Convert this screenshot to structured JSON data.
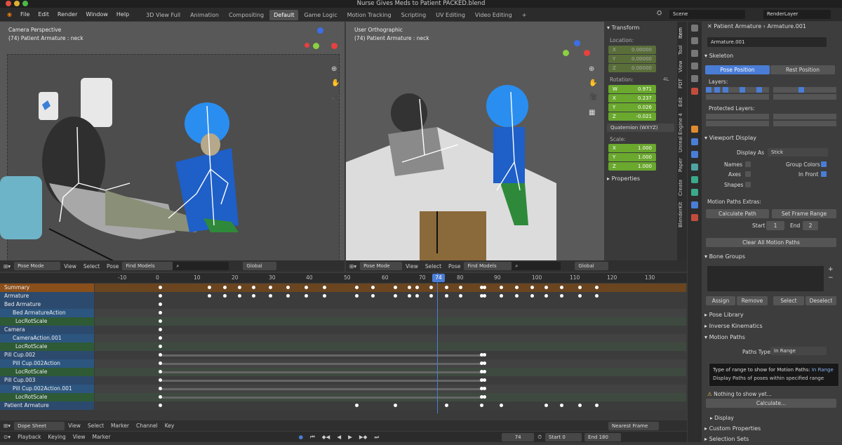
{
  "window_title": "Nurse Gives Meds to Patient PACKED.blend",
  "menus": [
    "File",
    "Edit",
    "Render",
    "Window",
    "Help"
  ],
  "workspaces": [
    "3D View Full",
    "Animation",
    "Compositing",
    "Default",
    "Game Logic",
    "Motion Tracking",
    "Scripting",
    "UV Editing",
    "Video Editing",
    "+"
  ],
  "active_workspace": "Default",
  "scene": "Scene",
  "render_layer": "RenderLayer",
  "left_viewport": {
    "label": "Camera Perspective",
    "sub": "(74) Patient Armature : neck"
  },
  "right_viewport": {
    "label": "User Orthographic",
    "sub": "(74) Patient Armature : neck"
  },
  "viewport_header": {
    "mode": "Pose Mode",
    "view": "View",
    "select": "Select",
    "pose": "Pose",
    "find": "Find Models",
    "orientation": "Global"
  },
  "transform": {
    "title": "Transform",
    "location_label": "Location:",
    "loc": [
      {
        "axis": "X",
        "val": "0.00000"
      },
      {
        "axis": "Y",
        "val": "0.00000"
      },
      {
        "axis": "Z",
        "val": "0.00000"
      }
    ],
    "rotation_label": "Rotation:",
    "rot_mode_tag": "4L",
    "rot": [
      {
        "axis": "W",
        "val": "0.971"
      },
      {
        "axis": "X",
        "val": "0.237"
      },
      {
        "axis": "Y",
        "val": "0.026"
      },
      {
        "axis": "Z",
        "val": "-0.021"
      }
    ],
    "rot_mode": "Quaternion (WXYZ)",
    "scale_label": "Scale:",
    "scale": [
      {
        "axis": "X",
        "val": "1.000"
      },
      {
        "axis": "Y",
        "val": "1.000"
      },
      {
        "axis": "Z",
        "val": "1.000"
      }
    ],
    "properties": "Properties"
  },
  "side_tabs": [
    "Item",
    "Tool",
    "View",
    "PDT",
    "Edit",
    "Unreal Engine 4",
    "Paper",
    "Create",
    "BlenderKit"
  ],
  "props": {
    "object": "Patient Armature",
    "data": "Armature.001",
    "name_field": "Armature.001",
    "skeleton": "Skeleton",
    "pose_position": "Pose Position",
    "rest_position": "Rest Position",
    "layers": "Layers:",
    "protected_layers": "Protected Layers:",
    "viewport_display": "Viewport Display",
    "display_as_label": "Display As",
    "display_as": "Stick",
    "names": "Names",
    "group_colors": "Group Colors",
    "axes": "Axes",
    "in_front": "In Front",
    "shapes": "Shapes",
    "motion_extras": "Motion Paths Extras:",
    "calculate_path": "Calculate Path",
    "set_frame_range": "Set Frame Range",
    "start_label": "Start",
    "start_val": "1",
    "end_label": "End",
    "end_val": "2",
    "clear_all": "Clear All Motion Paths",
    "bone_groups": "Bone Groups",
    "assign": "Assign",
    "remove": "Remove",
    "select": "Select",
    "deselect": "Deselect",
    "pose_library": "Pose Library",
    "inverse_kinematics": "Inverse Kinematics",
    "motion_paths": "Motion Paths",
    "paths_type_label": "Paths Type",
    "paths_type": "In Range",
    "tooltip_title": "Type of range to show for Motion Paths:",
    "tooltip_value": "In Range",
    "tooltip_desc": "Display Paths of poses within specified range",
    "nothing": "Nothing to show yet...",
    "calculate": "Calculate...",
    "display": "Display",
    "custom_props": "Custom Properties",
    "selection_sets": "Selection Sets"
  },
  "dope": {
    "ticks": [
      "-10",
      "0",
      "10",
      "20",
      "30",
      "40",
      "50",
      "60",
      "70",
      "74",
      "80",
      "90",
      "100",
      "110",
      "120",
      "130"
    ],
    "current_frame": "74",
    "rows": [
      {
        "label": "Summary",
        "kind": "summary"
      },
      {
        "label": "Armature",
        "kind": "obj"
      },
      {
        "label": "Bed Armature",
        "kind": "obj"
      },
      {
        "label": "Bed ArmatureAction",
        "kind": "action"
      },
      {
        "label": "LocRotScale",
        "kind": "group"
      },
      {
        "label": "Camera",
        "kind": "obj"
      },
      {
        "label": "CameraAction.001",
        "kind": "action"
      },
      {
        "label": "LocRotScale",
        "kind": "group"
      },
      {
        "label": "Pill Cup.002",
        "kind": "obj"
      },
      {
        "label": "Pill Cup.002Action",
        "kind": "action"
      },
      {
        "label": "LocRotScale",
        "kind": "group"
      },
      {
        "label": "Pill Cup.003",
        "kind": "obj"
      },
      {
        "label": "Pill Cup.002Action.001",
        "kind": "action"
      },
      {
        "label": "LocRotScale",
        "kind": "group"
      },
      {
        "label": "Patient Armature",
        "kind": "obj"
      }
    ],
    "header": {
      "mode": "Dope Sheet",
      "view": "View",
      "select": "Select",
      "marker": "Marker",
      "channel": "Channel",
      "key": "Key",
      "snap": "Nearest Frame"
    },
    "timeline": {
      "playback": "Playback",
      "keying": "Keying",
      "view": "View",
      "marker": "Marker",
      "frame": "74",
      "start_label": "Start",
      "start": "0",
      "end_label": "End",
      "end": "180"
    }
  },
  "colors": {
    "accent": "#4a7dd6",
    "green": "#6aa82e",
    "summary": "#9a5a1e"
  }
}
